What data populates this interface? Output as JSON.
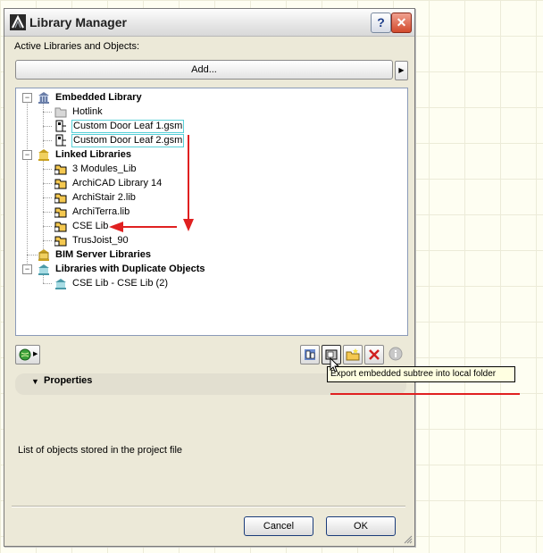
{
  "window": {
    "title": "Library Manager",
    "help_label": "?",
    "close_label": "✕"
  },
  "section_label": "Active Libraries and Objects:",
  "add_button": "Add...",
  "tree": {
    "embedded": "Embedded Library",
    "hotlink": "Hotlink",
    "door1": "Custom Door Leaf 1.gsm",
    "door2": "Custom Door Leaf 2.gsm",
    "linked": "Linked Libraries",
    "lib1": "3 Modules_Lib",
    "lib2": "ArchiCAD Library 14",
    "lib3": "ArchiStair 2.lib",
    "lib4": "ArchiTerra.lib",
    "lib5": "CSE Lib",
    "lib6": "TrusJoist_90",
    "bim": "BIM Server Libraries",
    "duplicates": "Libraries with Duplicate Objects",
    "dup1": "CSE Lib - CSE Lib (2)"
  },
  "properties_label": "Properties",
  "tooltip": "Export embedded subtree into local folder",
  "description": "List of objects stored in the project file",
  "cancel_button": "Cancel",
  "ok_button": "OK",
  "colors": {
    "annotation": "#e02020",
    "selection": "#58d0d8"
  }
}
